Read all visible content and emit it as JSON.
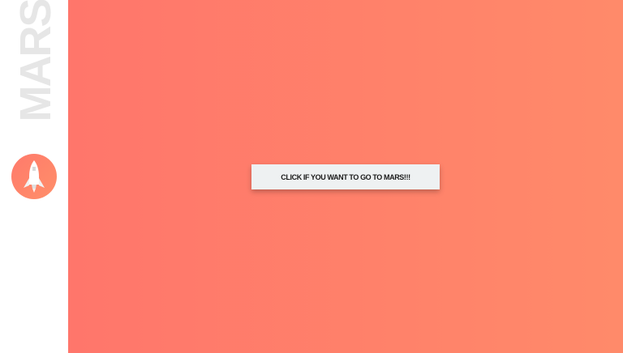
{
  "sidebar": {
    "brand": "MARS",
    "icon": "rocket-icon"
  },
  "main": {
    "cta_label": "CLICK IF YOU WANT TO GO TO MARS!!!"
  },
  "colors": {
    "gradient_start": "#ff766b",
    "gradient_end": "#ff8a6a",
    "button_bg": "#eef1f2",
    "brand_text": "#e6e6e6"
  }
}
